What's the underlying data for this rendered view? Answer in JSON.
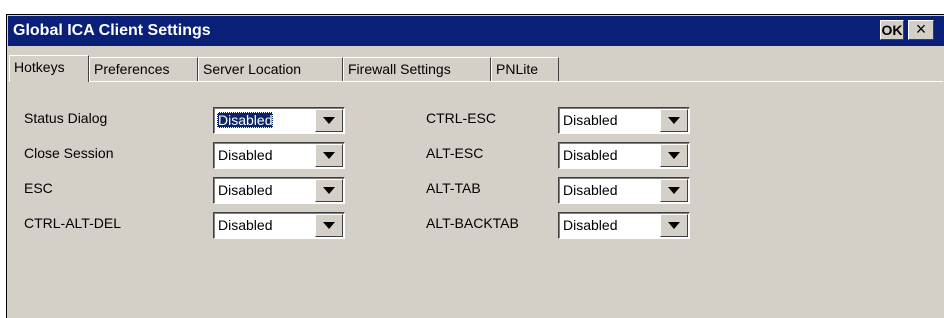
{
  "window": {
    "title": "Global ICA Client Settings",
    "ok_label": "OK",
    "close_label": "×"
  },
  "tabs": [
    {
      "label": "Hotkeys",
      "active": true
    },
    {
      "label": "Preferences",
      "active": false
    },
    {
      "label": "Server Location",
      "active": false
    },
    {
      "label": "Firewall Settings",
      "active": false
    },
    {
      "label": "PNLite",
      "active": false
    }
  ],
  "hotkeys": {
    "left": [
      {
        "label": "Status Dialog",
        "value": "Disabled",
        "focused": true
      },
      {
        "label": "Close Session",
        "value": "Disabled",
        "focused": false
      },
      {
        "label": "ESC",
        "value": "Disabled",
        "focused": false
      },
      {
        "label": "CTRL-ALT-DEL",
        "value": "Disabled",
        "focused": false
      }
    ],
    "right": [
      {
        "label": "CTRL-ESC",
        "value": "Disabled",
        "focused": false
      },
      {
        "label": "ALT-ESC",
        "value": "Disabled",
        "focused": false
      },
      {
        "label": "ALT-TAB",
        "value": "Disabled",
        "focused": false
      },
      {
        "label": "ALT-BACKTAB",
        "value": "Disabled",
        "focused": false
      }
    ]
  },
  "colors": {
    "titlebar": "#0a2078",
    "face": "#d4d0c8",
    "selection": "#0a246a"
  },
  "icons": {
    "dropdown": "chevron-down-icon"
  }
}
